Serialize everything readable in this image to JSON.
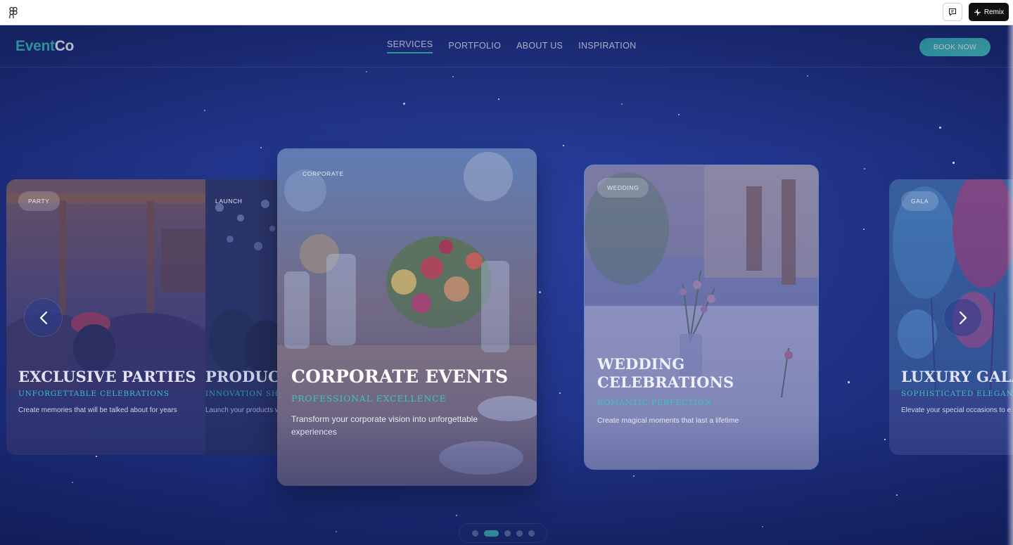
{
  "app": {
    "comment_icon": "comment-icon",
    "remix_label": "Remix",
    "remix_icon": "remix-icon",
    "figma_icon": "figma-logo-icon"
  },
  "header": {
    "logo_part1": "Event",
    "logo_part2": "Co",
    "nav": [
      {
        "label": "SERVICES",
        "active": true
      },
      {
        "label": "PORTFOLIO",
        "active": false
      },
      {
        "label": "ABOUT US",
        "active": false
      },
      {
        "label": "INSPIRATION",
        "active": false
      }
    ],
    "book_label": "BOOK NOW"
  },
  "cards": {
    "party": {
      "tag": "PARTY",
      "title": "EXCLUSIVE PARTIES",
      "subtitle": "UNFORGETTABLE CELEBRATIONS",
      "desc": "Create memories that will be talked about for years"
    },
    "launch": {
      "tag": "LAUNCH",
      "title": "PRODUCT",
      "subtitle": "INNOVATION SHOW",
      "desc": "Launch your products with impact and style"
    },
    "corporate": {
      "tag": "CORPORATE",
      "title": "CORPORATE EVENTS",
      "subtitle": "PROFESSIONAL EXCELLENCE",
      "desc": "Transform your corporate vision into unforgettable experiences"
    },
    "wedding": {
      "tag": "WEDDING",
      "title": "WEDDING CELEBRATIONS",
      "subtitle": "ROMANTIC PERFECTION",
      "desc": "Create magical moments that last a lifetime"
    },
    "gala": {
      "tag": "GALA",
      "title": "LUXURY GALA",
      "subtitle": "SOPHISTICATED ELEGANCE",
      "desc": "Elevate your special occasions to e"
    }
  },
  "carousel": {
    "prev_icon": "chevron-left-icon",
    "next_icon": "chevron-right-icon",
    "slide_count": 5,
    "active_slide": 2
  },
  "colors": {
    "accent": "#3ec1c1",
    "background": "#21348a",
    "text": "#ffffff"
  }
}
